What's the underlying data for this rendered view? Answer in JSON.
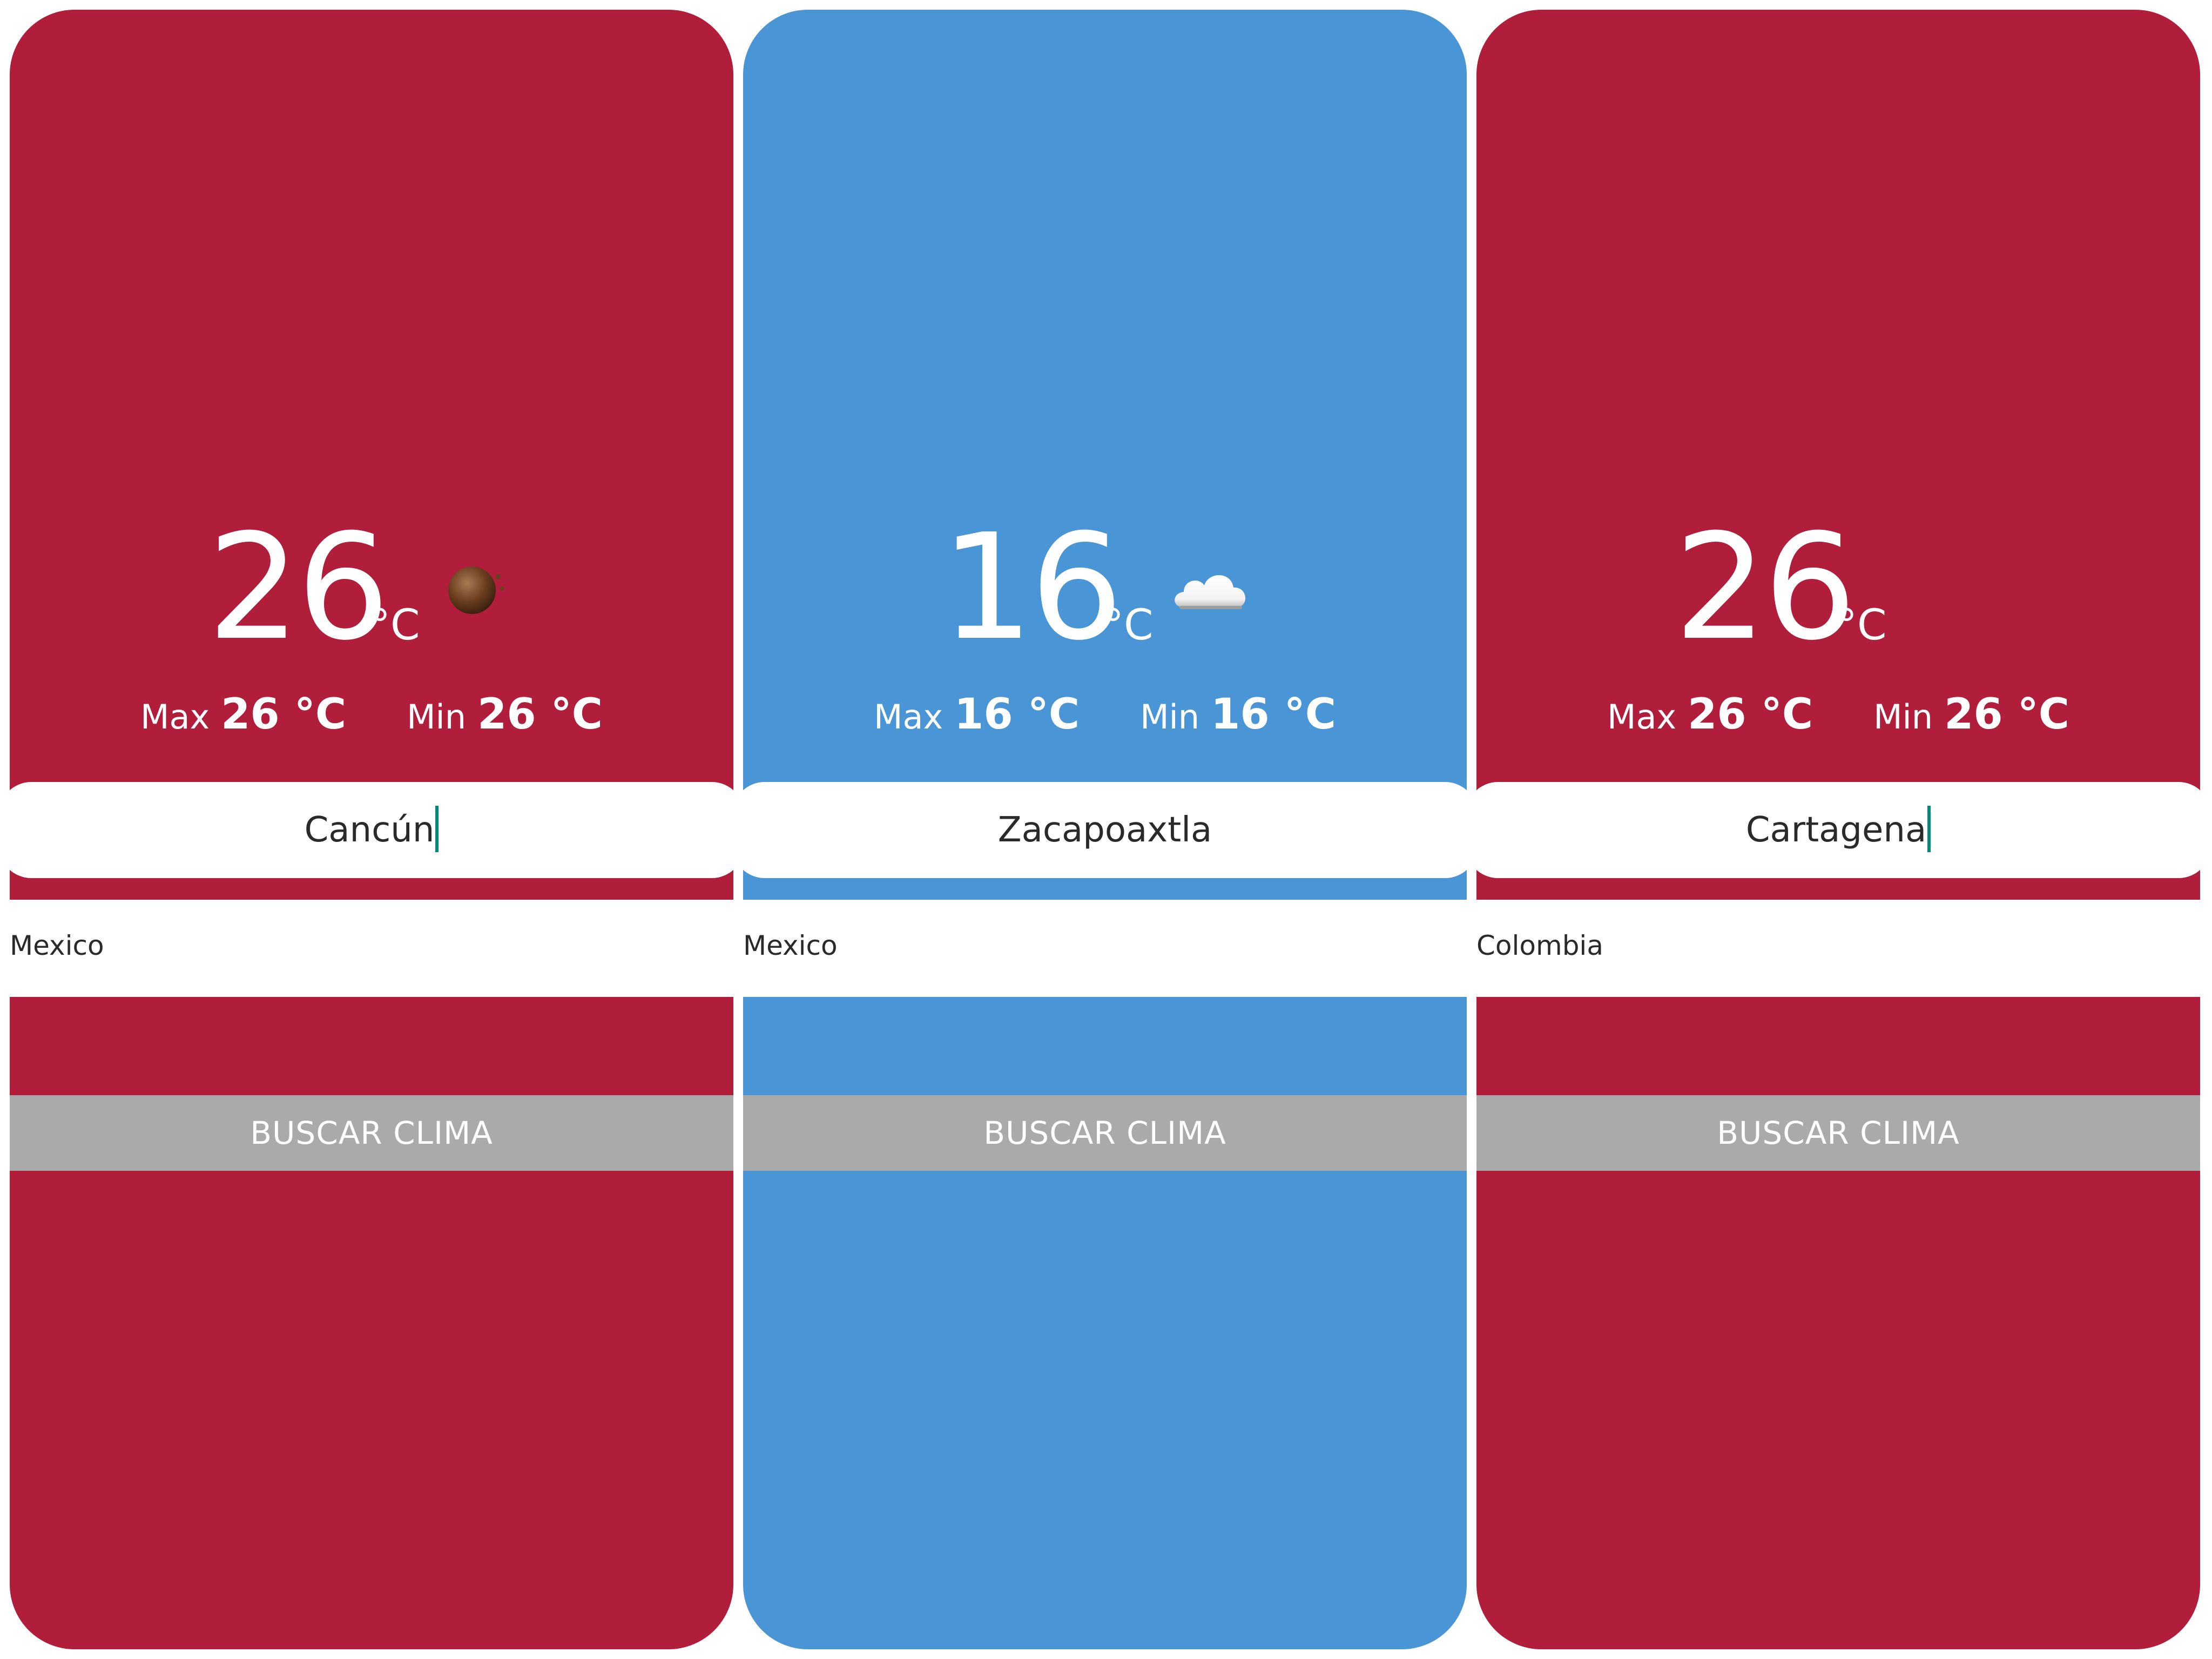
{
  "cards": [
    {
      "temperature": "26",
      "unit": "°C",
      "condition_icon": "sun-icon",
      "max_label": "Max",
      "max_value": "26 °C",
      "min_label": "Min",
      "min_value": "26 °C",
      "city_input": "Cancún",
      "country": "Mexico",
      "button_label": "BUSCAR CLIMA",
      "background_color": "#b01e3c"
    },
    {
      "temperature": "16",
      "unit": "°C",
      "condition_icon": "cloud-icon",
      "max_label": "Max",
      "max_value": "16 °C",
      "min_label": "Min",
      "min_value": "16 °C",
      "city_input": "Zacapoaxtla",
      "country": "Mexico",
      "button_label": "BUSCAR CLIMA",
      "background_color": "#4a95d5"
    },
    {
      "temperature": "26",
      "unit": "°C",
      "condition_icon": "",
      "max_label": "Max",
      "max_value": "26 °C",
      "min_label": "Min",
      "min_value": "26 °C",
      "city_input": "Cartagena",
      "country": "Colombia",
      "button_label": "BUSCAR CLIMA",
      "background_color": "#b01e3c"
    }
  ],
  "colors": {
    "warm": "#b01e3c",
    "cool": "#4a95d5",
    "button": "#aaaaaa",
    "caret": "#00897b"
  }
}
